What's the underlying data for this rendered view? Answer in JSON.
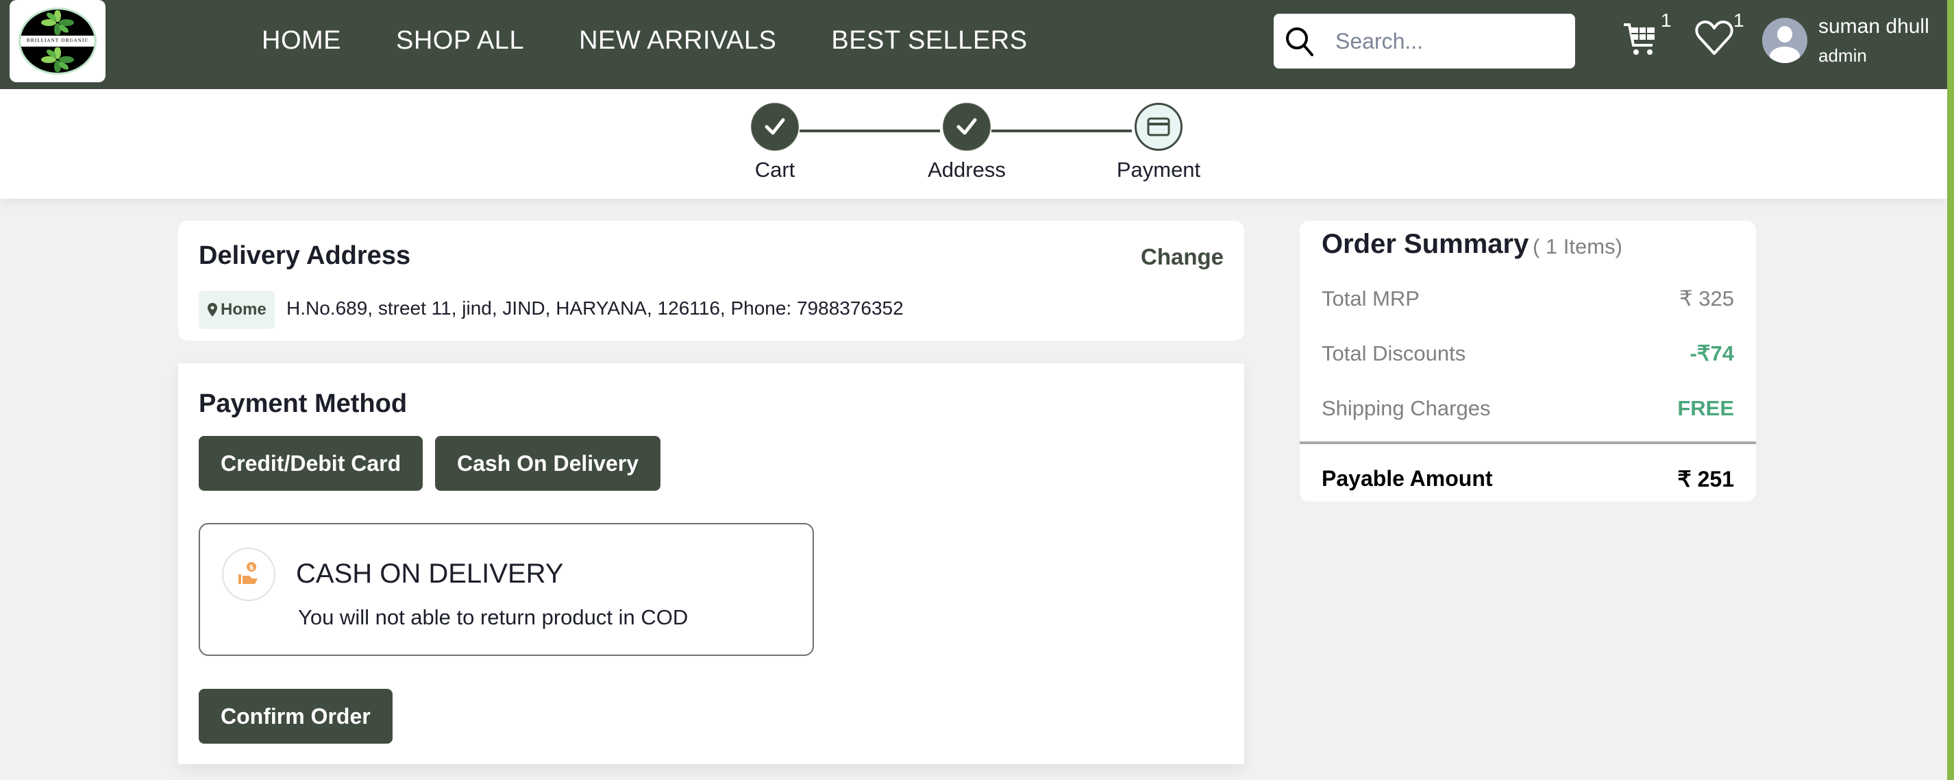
{
  "brand": {
    "logo_text": "BRILLIANT ORGANIC",
    "primary_color": "#414c40",
    "accent_bar_color": "#8bb84a"
  },
  "nav": {
    "items": [
      {
        "label": "HOME"
      },
      {
        "label": "SHOP ALL"
      },
      {
        "label": "NEW ARRIVALS"
      },
      {
        "label": "BEST SELLERS"
      }
    ]
  },
  "search": {
    "placeholder": "Search...",
    "value": ""
  },
  "header_icons": {
    "cart_count": "1",
    "wishlist_count": "1"
  },
  "user": {
    "name": "suman dhull",
    "role": "admin"
  },
  "stepper": {
    "steps": [
      {
        "label": "Cart",
        "status": "completed",
        "icon": "check-icon"
      },
      {
        "label": "Address",
        "status": "completed",
        "icon": "check-icon"
      },
      {
        "label": "Payment",
        "status": "active",
        "icon": "credit-card-icon"
      }
    ]
  },
  "delivery_address": {
    "title": "Delivery Address",
    "change_label": "Change",
    "tag_label": "Home",
    "address": "H.No.689, street 11, jind, JIND, HARYANA, 126116, Phone: 7988376352"
  },
  "payment": {
    "title": "Payment Method",
    "methods": [
      {
        "label": "Credit/Debit Card"
      },
      {
        "label": "Cash On Delivery"
      }
    ],
    "selected": {
      "title": "CASH ON DELIVERY",
      "description": "You will not able to return product in COD",
      "icon": "cash-in-hand-icon"
    },
    "confirm_label": "Confirm Order"
  },
  "order_summary": {
    "title": "Order Summary",
    "items_count": "( 1 Items)",
    "rows": [
      {
        "label": "Total MRP",
        "value": "₹ 325"
      },
      {
        "label": "Total Discounts",
        "value": "-₹74"
      },
      {
        "label": "Shipping Charges",
        "value": "FREE"
      }
    ],
    "payable_label": "Payable Amount",
    "payable_value": "₹ 251"
  }
}
